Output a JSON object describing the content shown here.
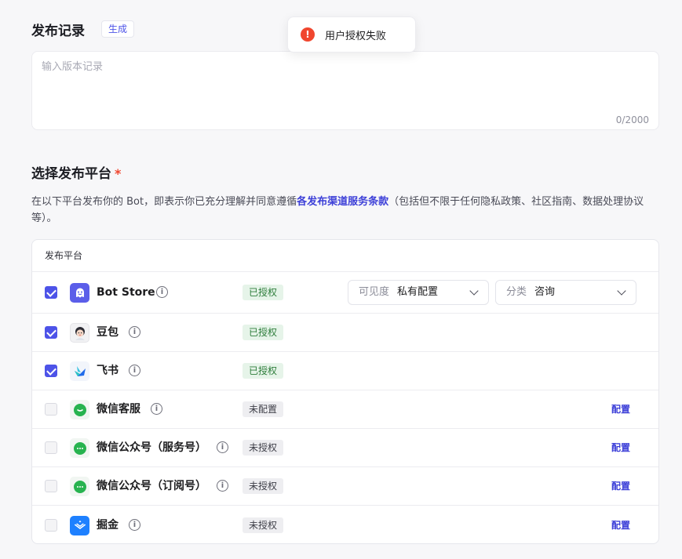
{
  "release": {
    "title": "发布记录",
    "generate_label": "生成",
    "placeholder": "输入版本记录",
    "char_count": "0/2000"
  },
  "toast": {
    "message": "用户授权失败"
  },
  "platforms_section": {
    "title": "选择发布平台",
    "required_mark": "*",
    "desc_before": "在以下平台发布你的 Bot，即表示你已充分理解并同意遵循",
    "desc_link": "各发布渠道服务条款",
    "desc_after": "（包括但不限于任何隐私政策、社区指南、数据处理协议等）。",
    "table_header": "发布平台"
  },
  "rows": [
    {
      "name": "Bot Store",
      "status": "已授权",
      "checked": true,
      "icon": "bot-store-icon",
      "color": "#5b5ee9"
    },
    {
      "name": "豆包",
      "status": "已授权",
      "checked": true,
      "icon": "doubao-avatar-icon",
      "color": "#f2f2f4"
    },
    {
      "name": "飞书",
      "status": "已授权",
      "checked": true,
      "icon": "feishu-icon",
      "color": "#f2f5fb"
    },
    {
      "name": "微信客服",
      "status": "未配置",
      "checked": false,
      "icon": "wechat-icon",
      "color": "#27b34f",
      "action": "配置"
    },
    {
      "name": "微信公众号（服务号）",
      "status": "未授权",
      "checked": false,
      "icon": "wechat-icon",
      "color": "#27b34f",
      "action": "配置"
    },
    {
      "name": "微信公众号（订阅号）",
      "status": "未授权",
      "checked": false,
      "icon": "wechat-icon",
      "color": "#27b34f",
      "action": "配置"
    },
    {
      "name": "掘金",
      "status": "未授权",
      "checked": false,
      "icon": "juejin-icon",
      "color": "#1e80ff",
      "action": "配置"
    }
  ],
  "bot_store_options": {
    "visibility_label": "可见度",
    "visibility_value": "私有配置",
    "category_label": "分类",
    "category_value": "咨询"
  }
}
